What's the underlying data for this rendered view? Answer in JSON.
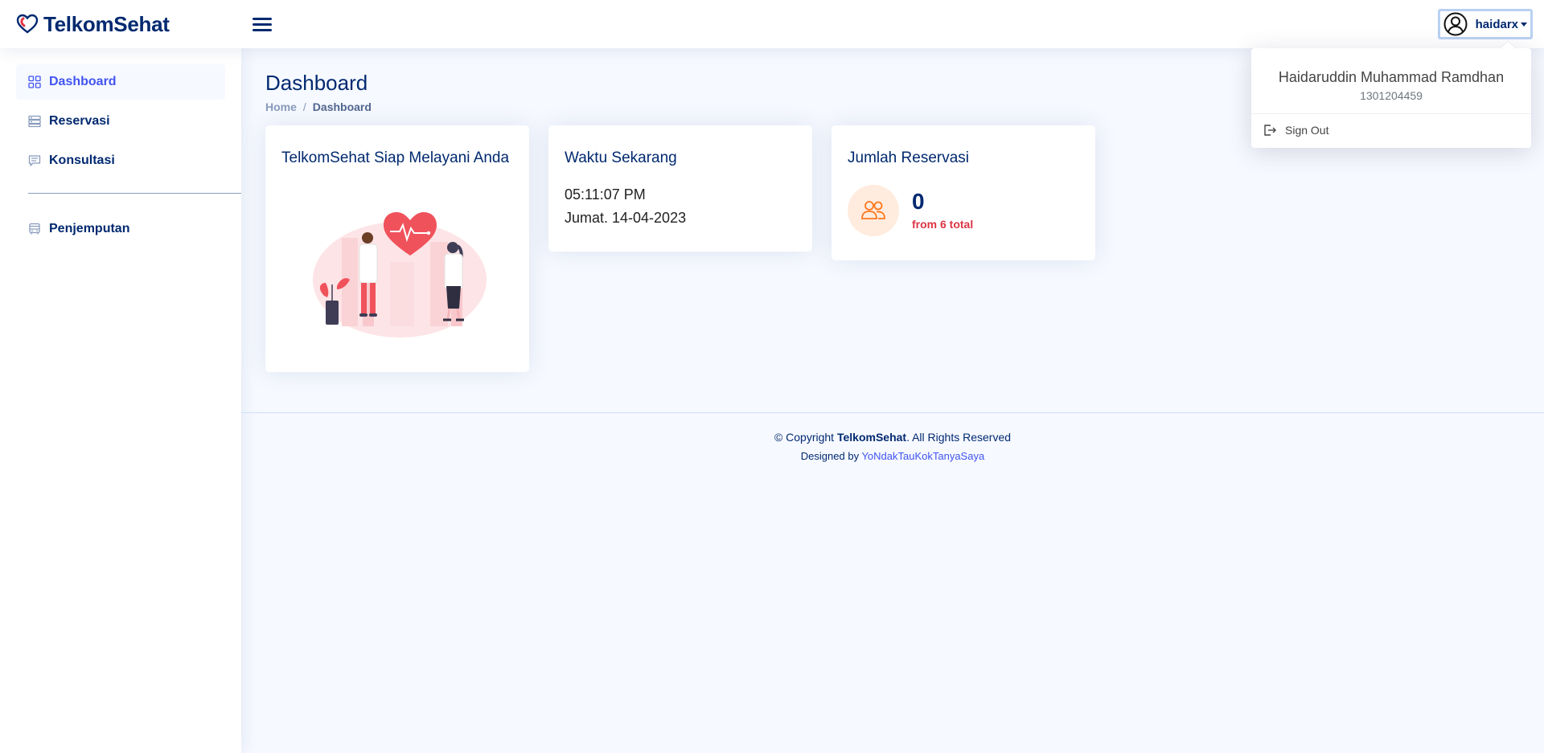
{
  "app": {
    "brand": "TelkomSehat"
  },
  "header": {
    "username": "haidarx"
  },
  "profile_menu": {
    "full_name": "Haidaruddin Muhammad Ramdhan",
    "nim": "1301204459",
    "sign_out_label": "Sign Out"
  },
  "sidebar": {
    "items": [
      {
        "label": "Dashboard",
        "icon": "grid-icon",
        "active": true
      },
      {
        "label": "Reservasi",
        "icon": "list-icon",
        "active": false
      },
      {
        "label": "Konsultasi",
        "icon": "chat-icon",
        "active": false
      },
      {
        "label": "Penjemputan",
        "icon": "bus-icon",
        "active": false
      }
    ]
  },
  "page": {
    "title": "Dashboard",
    "breadcrumb": [
      "Home",
      "/",
      "Dashboard"
    ]
  },
  "cards": {
    "welcome": {
      "title": "TelkomSehat Siap Melayani Anda"
    },
    "clock": {
      "title": "Waktu Sekarang",
      "time": "05:11:07 PM",
      "date": "Jumat. 14-04-2023"
    },
    "reservations": {
      "title": "Jumlah Reservasi",
      "count": "0",
      "total_text": "from 6 total"
    }
  },
  "footer": {
    "copyright_prefix": "© Copyright ",
    "copyright_brand": "TelkomSehat",
    "copyright_suffix": ". All Rights Reserved",
    "designed_by_prefix": "Designed by ",
    "designer": "YoNdakTauKokTanyaSaya"
  },
  "colors": {
    "primary": "#012970",
    "accent": "#4154f1",
    "danger": "#dc3545",
    "reservation_icon_bg": "#ffecdf",
    "reservation_icon": "#ff771d"
  }
}
